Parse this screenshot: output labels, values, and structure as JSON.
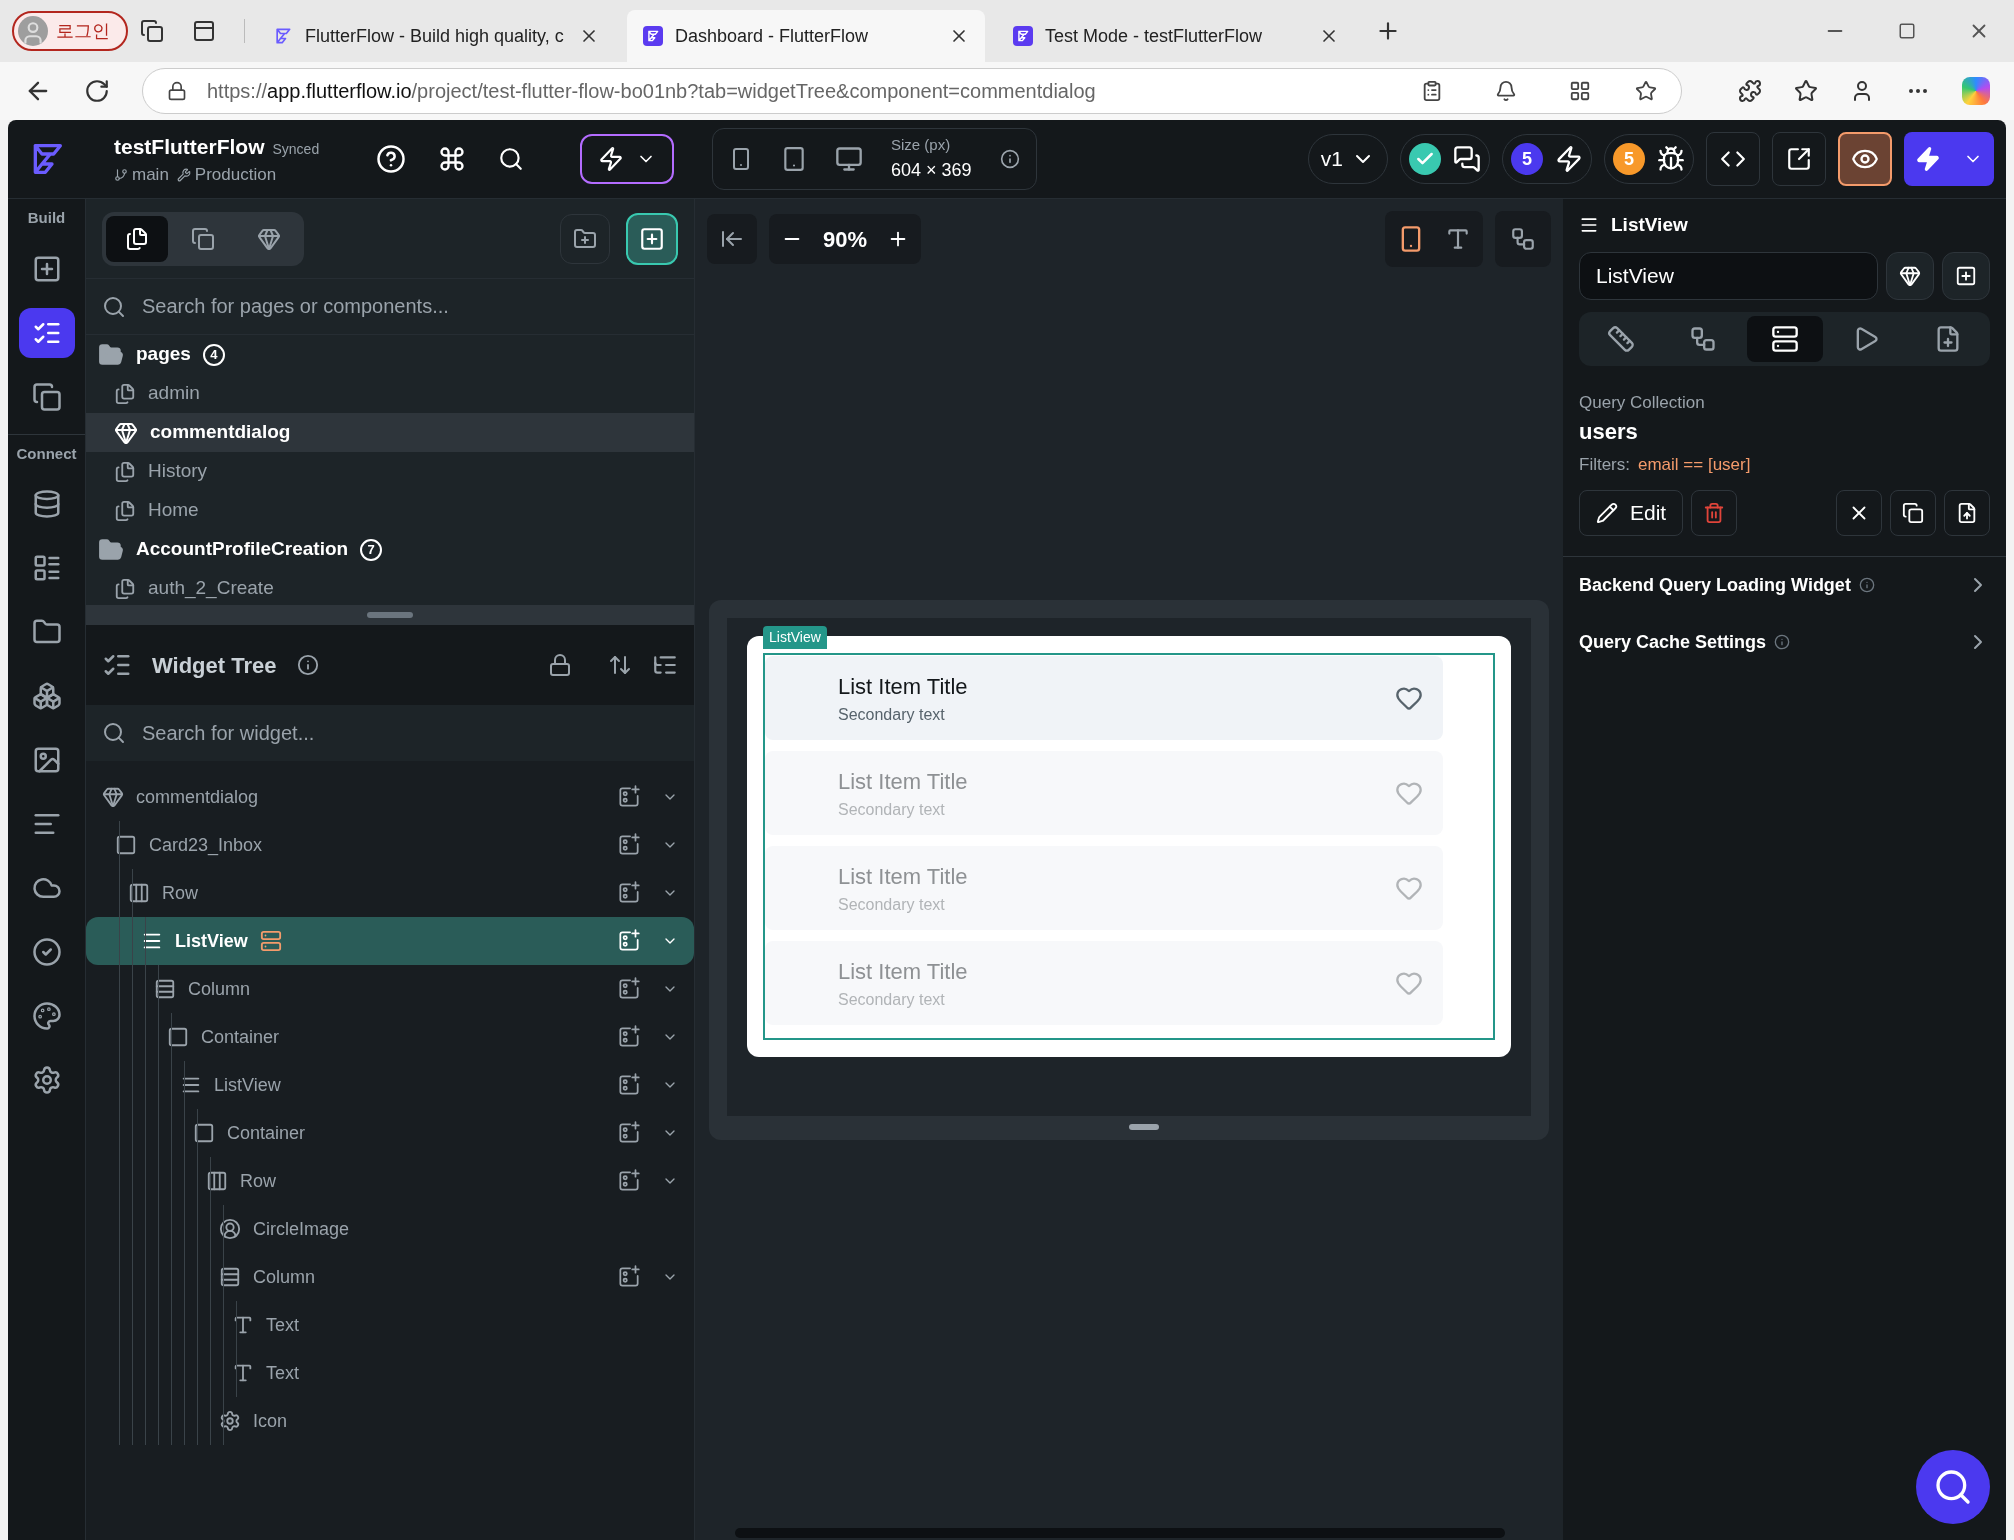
{
  "browser": {
    "profile_label": "로그인",
    "tabs": [
      {
        "title": "FlutterFlow - Build high quality, c",
        "selected": false,
        "kind": "outline"
      },
      {
        "title": "Dashboard - FlutterFlow",
        "selected": true,
        "kind": "filled"
      },
      {
        "title": "Test Mode - testFlutterFlow",
        "selected": false,
        "kind": "filled"
      }
    ],
    "url": {
      "scheme": "https://",
      "host": "app.flutterflow.io",
      "path": "/project/test-flutter-flow-bo01nb?tab=widgetTree&component=commentdialog"
    }
  },
  "header": {
    "project_name": "testFlutterFlow",
    "sync_status": "Synced",
    "branch": "main",
    "environment": "Production",
    "size_label": "Size (px)",
    "size_value": "604 × 369",
    "version": "v1",
    "issues_count": "5",
    "bugs_count": "5"
  },
  "rail": {
    "sections": [
      {
        "title": "Build",
        "items": [
          {
            "kind": "add",
            "selected": false
          },
          {
            "kind": "tree",
            "selected": true
          },
          {
            "kind": "storyboard",
            "selected": false
          }
        ]
      },
      {
        "title": "Connect",
        "items": [
          {
            "kind": "database",
            "selected": false
          },
          {
            "kind": "schema",
            "selected": false
          },
          {
            "kind": "media",
            "selected": false
          },
          {
            "kind": "team",
            "selected": false
          },
          {
            "kind": "image",
            "selected": false
          },
          {
            "kind": "logs",
            "selected": false
          },
          {
            "kind": "cloud",
            "selected": false
          },
          {
            "kind": "tests",
            "selected": false
          },
          {
            "kind": "theme",
            "selected": false
          },
          {
            "kind": "settings",
            "selected": false
          }
        ]
      }
    ]
  },
  "pages_panel": {
    "view_tabs": [
      {
        "kind": "all",
        "selected": true
      },
      {
        "kind": "pages",
        "selected": false
      },
      {
        "kind": "components",
        "selected": false
      }
    ],
    "search_placeholder": "Search for pages or components...",
    "folders": [
      {
        "name": "pages",
        "count": "4",
        "items": [
          {
            "name": "admin",
            "kind": "page",
            "selected": false
          },
          {
            "name": "commentdialog",
            "kind": "component",
            "selected": true
          },
          {
            "name": "History",
            "kind": "page",
            "selected": false
          },
          {
            "name": "Home",
            "kind": "page",
            "selected": false
          }
        ]
      },
      {
        "name": "AccountProfileCreation",
        "count": "7",
        "items": [
          {
            "name": "auth_2_Create",
            "kind": "page",
            "selected": false
          }
        ]
      }
    ]
  },
  "widget_tree": {
    "title": "Widget Tree",
    "search_placeholder": "Search for widget...",
    "nodes": [
      {
        "label": "commentdialog",
        "kind": "component",
        "selected": false,
        "children": [
          {
            "label": "Card23_Inbox",
            "kind": "container",
            "selected": false,
            "children": [
              {
                "label": "Row",
                "kind": "row",
                "selected": false,
                "children": [
                  {
                    "label": "ListView",
                    "kind": "listview",
                    "selected": true,
                    "backend_query": true,
                    "children": [
                      {
                        "label": "Column",
                        "kind": "column",
                        "selected": false,
                        "children": [
                          {
                            "label": "Container",
                            "kind": "container",
                            "selected": false,
                            "children": [
                              {
                                "label": "ListView",
                                "kind": "listview",
                                "selected": false,
                                "children": [
                                  {
                                    "label": "Container",
                                    "kind": "container",
                                    "selected": false,
                                    "children": [
                                      {
                                        "label": "Row",
                                        "kind": "row",
                                        "selected": false,
                                        "children": [
                                          {
                                            "label": "CircleImage",
                                            "kind": "image",
                                            "selected": false
                                          },
                                          {
                                            "label": "Column",
                                            "kind": "column",
                                            "selected": false,
                                            "children": [
                                              {
                                                "label": "Text",
                                                "kind": "text",
                                                "selected": false
                                              },
                                              {
                                                "label": "Text",
                                                "kind": "text",
                                                "selected": false
                                              }
                                            ]
                                          },
                                          {
                                            "label": "Icon",
                                            "kind": "icon",
                                            "selected": false
                                          }
                                        ]
                                      }
                                    ]
                                  }
                                ]
                              }
                            ]
                          }
                        ]
                      }
                    ]
                  }
                ]
              }
            ]
          }
        ]
      }
    ]
  },
  "canvas": {
    "zoom": "90%",
    "widget_label": "ListView",
    "items": [
      {
        "title": "List Item Title",
        "subtitle": "Secondary text",
        "dimmed": false
      },
      {
        "title": "List Item Title",
        "subtitle": "Secondary text",
        "dimmed": true
      },
      {
        "title": "List Item Title",
        "subtitle": "Secondary text",
        "dimmed": true
      },
      {
        "title": "List Item Title",
        "subtitle": "Secondary text",
        "dimmed": true
      }
    ]
  },
  "properties": {
    "widget_type": "ListView",
    "name_value": "ListView",
    "tabs": [
      {
        "kind": "properties",
        "selected": false
      },
      {
        "kind": "actions",
        "selected": false
      },
      {
        "kind": "backend",
        "selected": true
      },
      {
        "kind": "animations",
        "selected": false
      },
      {
        "kind": "docs",
        "selected": false
      }
    ],
    "query_label": "Query Collection",
    "collection": "users",
    "filters_label": "Filters:",
    "filter": "email == [user]",
    "edit_label": "Edit",
    "sections": [
      "Backend Query Loading Widget",
      "Query Cache Settings"
    ]
  }
}
